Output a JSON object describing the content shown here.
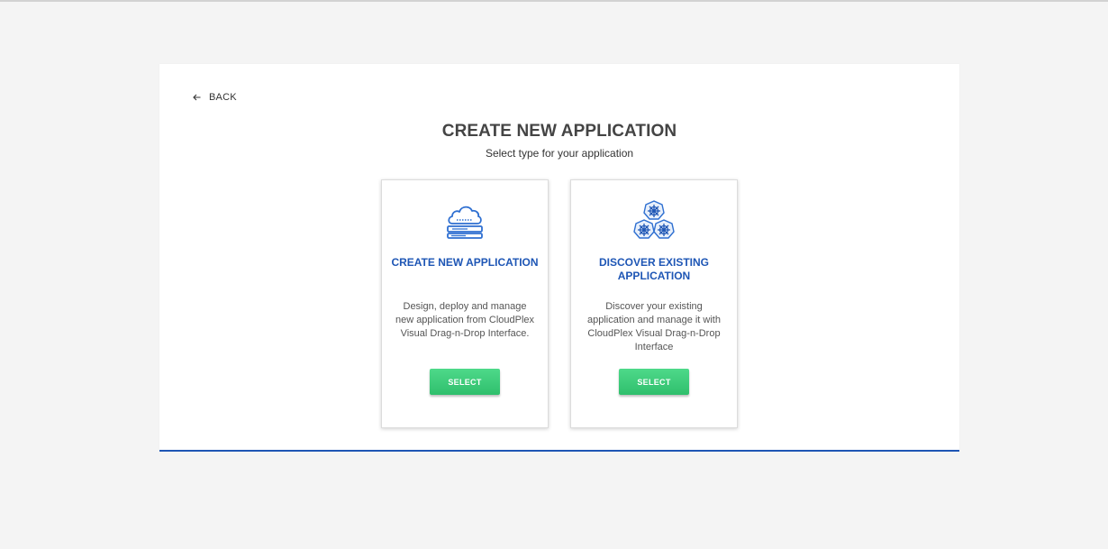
{
  "header": {
    "back_label": "BACK",
    "title": "CREATE NEW APPLICATION",
    "subtitle": "Select type for your application"
  },
  "cards": [
    {
      "icon": "cloud-server-icon",
      "title": "CREATE NEW APPLICATION",
      "description": "Design, deploy and manage new application from CloudPlex Visual Drag-n-Drop Interface.",
      "button_label": "SELECT"
    },
    {
      "icon": "kubernetes-cluster-icon",
      "title": "DISCOVER EXISTING APPLICATION",
      "description": "Discover your existing application and manage it with CloudPlex Visual Drag-n-Drop Interface",
      "button_label": "SELECT"
    }
  ],
  "colors": {
    "accent": "#1e56b5",
    "button": "#3ecb78",
    "background": "#f4f4f4"
  }
}
